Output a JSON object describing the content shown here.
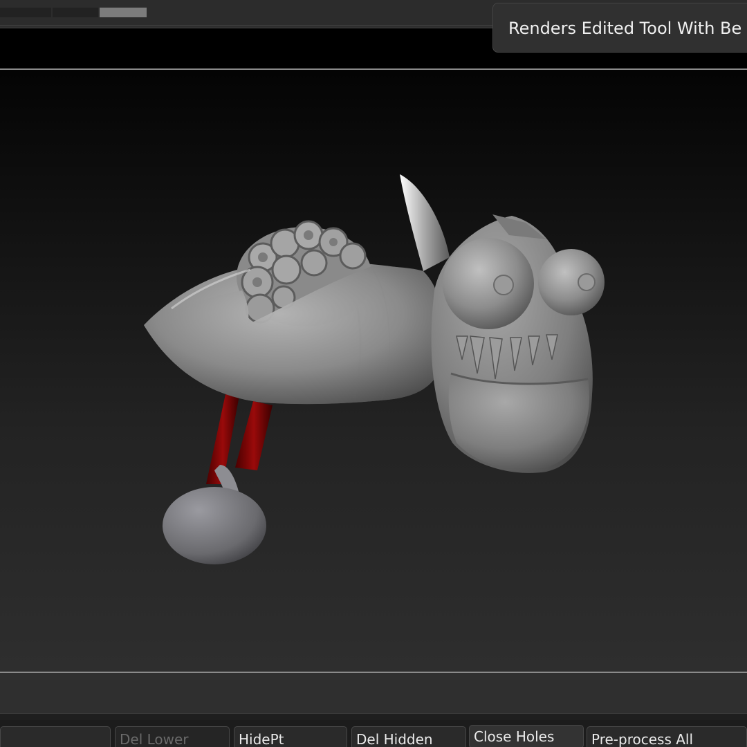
{
  "tooltip": {
    "text": "Renders Edited Tool With Be"
  },
  "viewport": {
    "background_top": "#040404",
    "background_bottom": "#2e2e2e",
    "model_color": "#8f8f8f",
    "accent_red": "#8b0000"
  },
  "buttons": {
    "del_lower": "Del Lower",
    "hide_pt": "HidePt",
    "del_hidden": "Del Hidden",
    "close_holes": "Close Holes",
    "preprocess_all": "Pre-process All"
  }
}
